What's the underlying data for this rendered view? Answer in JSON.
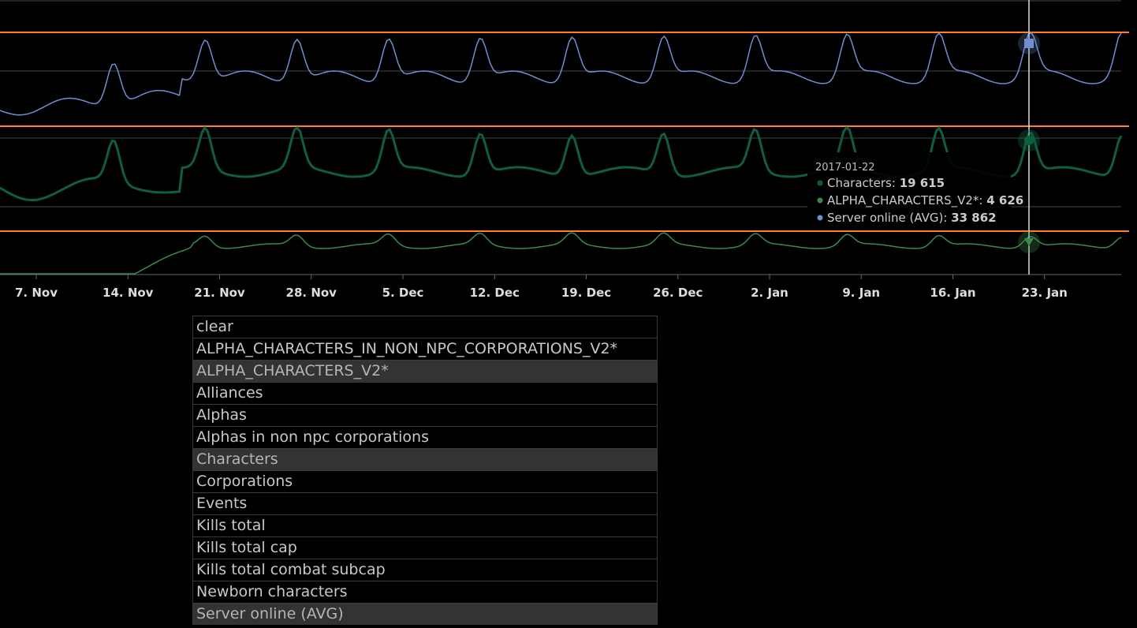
{
  "chart_data": {
    "type": "line",
    "x_tick_labels": [
      "7. Nov",
      "14. Nov",
      "21. Nov",
      "28. Nov",
      "5. Dec",
      "12. Dec",
      "19. Dec",
      "26. Dec",
      "2. Jan",
      "9. Jan",
      "16. Jan",
      "23. Jan"
    ],
    "x_range": [
      "2016-11-04",
      "2017-01-28"
    ],
    "series": [
      {
        "name": "Server online (AVG)",
        "color": "#6f8fd0",
        "marker": "square"
      },
      {
        "name": "Characters",
        "color": "#0f5e3e",
        "marker": "circle"
      },
      {
        "name": "ALPHA_CHARACTERS_V2*",
        "color": "#3b8a4c",
        "marker": "triangle"
      }
    ],
    "tooltip": {
      "date": "2017-01-22",
      "rows": [
        {
          "label": "Characters",
          "value": "19 615",
          "color": "#0f5e3e"
        },
        {
          "label": "ALPHA_CHARACTERS_V2*",
          "value": "4 626",
          "color": "#3b8a4c"
        },
        {
          "label": "Server online (AVG)",
          "value": "33 862",
          "color": "#6f8fd0"
        }
      ]
    },
    "crosshair_date": "2017-01-22",
    "threshold_color": "#ff7f2a",
    "grid": true
  },
  "metric_list": [
    {
      "label": "clear",
      "selected": false
    },
    {
      "label": "ALPHA_CHARACTERS_IN_NON_NPC_CORPORATIONS_V2*",
      "selected": false
    },
    {
      "label": "ALPHA_CHARACTERS_V2*",
      "selected": true
    },
    {
      "label": "Alliances",
      "selected": false
    },
    {
      "label": "Alphas",
      "selected": false
    },
    {
      "label": "Alphas in non npc corporations",
      "selected": false
    },
    {
      "label": "Characters",
      "selected": true
    },
    {
      "label": "Corporations",
      "selected": false
    },
    {
      "label": "Events",
      "selected": false
    },
    {
      "label": "Kills total",
      "selected": false
    },
    {
      "label": "Kills total cap",
      "selected": false
    },
    {
      "label": "Kills total combat subcap",
      "selected": false
    },
    {
      "label": "Newborn characters",
      "selected": false
    },
    {
      "label": "Server online (AVG)",
      "selected": true
    }
  ]
}
